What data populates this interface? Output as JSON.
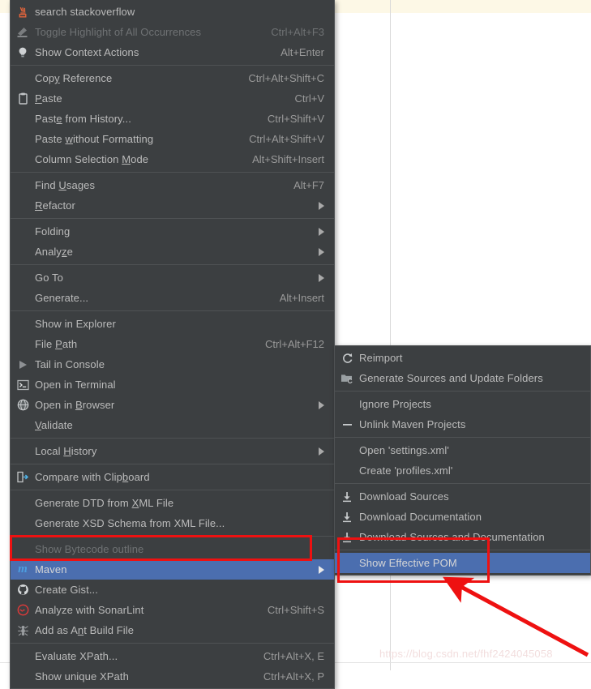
{
  "page": {
    "background": "#ffffff",
    "top_band_color": "#fdf8e6",
    "watermark": "https://blog.csdn.net/fhf2424045058"
  },
  "theme": {
    "menu_bg": "#3c3f41",
    "menu_border": "#4f5254",
    "text": "#bbbbbb",
    "disabled_text": "#6f7274",
    "accel_text": "#9a9a9a",
    "selection": "#4b6eaf",
    "annotation_red": "#ee1111",
    "maven_blue": "#4c9ee0"
  },
  "context_menu": {
    "name": "editor-context-menu",
    "groups": [
      {
        "items": [
          {
            "label": "search stackoverflow",
            "accel": "",
            "icon": "stackoverflow-icon",
            "disabled": false,
            "submenu": false
          },
          {
            "label": "Toggle Highlight of All Occurrences",
            "accel": "Ctrl+Alt+F3",
            "icon": "highlighter-icon",
            "disabled": true,
            "submenu": false
          },
          {
            "label": "Show Context Actions",
            "accel": "Alt+Enter",
            "icon": "lightbulb-icon",
            "disabled": false,
            "submenu": false
          }
        ]
      },
      {
        "items": [
          {
            "label": "Copy Reference",
            "accel": "Ctrl+Alt+Shift+C",
            "icon": "",
            "disabled": false,
            "submenu": false,
            "mnemonic": "y"
          },
          {
            "label": "Paste",
            "accel": "Ctrl+V",
            "icon": "clipboard-icon",
            "disabled": false,
            "submenu": false,
            "mnemonic": "P"
          },
          {
            "label": "Paste from History...",
            "accel": "Ctrl+Shift+V",
            "icon": "",
            "disabled": false,
            "submenu": false,
            "mnemonic": "e"
          },
          {
            "label": "Paste without Formatting",
            "accel": "Ctrl+Alt+Shift+V",
            "icon": "",
            "disabled": false,
            "submenu": false,
            "mnemonic": "w"
          },
          {
            "label": "Column Selection Mode",
            "accel": "Alt+Shift+Insert",
            "icon": "",
            "disabled": false,
            "submenu": false,
            "mnemonic": "M"
          }
        ]
      },
      {
        "items": [
          {
            "label": "Find Usages",
            "accel": "Alt+F7",
            "icon": "",
            "disabled": false,
            "submenu": false,
            "mnemonic": "U"
          },
          {
            "label": "Refactor",
            "accel": "",
            "icon": "",
            "disabled": false,
            "submenu": true,
            "mnemonic": "R"
          }
        ]
      },
      {
        "items": [
          {
            "label": "Folding",
            "accel": "",
            "icon": "",
            "disabled": false,
            "submenu": true
          },
          {
            "label": "Analyze",
            "accel": "",
            "icon": "",
            "disabled": false,
            "submenu": true,
            "mnemonic": "z"
          }
        ]
      },
      {
        "items": [
          {
            "label": "Go To",
            "accel": "",
            "icon": "",
            "disabled": false,
            "submenu": true
          },
          {
            "label": "Generate...",
            "accel": "Alt+Insert",
            "icon": "",
            "disabled": false,
            "submenu": false
          }
        ]
      },
      {
        "items": [
          {
            "label": "Show in Explorer",
            "accel": "",
            "icon": "",
            "disabled": false,
            "submenu": false
          },
          {
            "label": "File Path",
            "accel": "Ctrl+Alt+F12",
            "icon": "",
            "disabled": false,
            "submenu": false,
            "mnemonic": "P"
          },
          {
            "label": "Tail in Console",
            "accel": "",
            "icon": "play-icon",
            "disabled": false,
            "submenu": false
          },
          {
            "label": "Open in Terminal",
            "accel": "",
            "icon": "terminal-icon",
            "disabled": false,
            "submenu": false
          },
          {
            "label": "Open in Browser",
            "accel": "",
            "icon": "globe-icon",
            "disabled": false,
            "submenu": true,
            "mnemonic": "B"
          },
          {
            "label": "Validate",
            "accel": "",
            "icon": "",
            "disabled": false,
            "submenu": false,
            "mnemonic": "V"
          }
        ]
      },
      {
        "items": [
          {
            "label": "Local History",
            "accel": "",
            "icon": "",
            "disabled": false,
            "submenu": true,
            "mnemonic": "H"
          }
        ]
      },
      {
        "items": [
          {
            "label": "Compare with Clipboard",
            "accel": "",
            "icon": "compare-icon",
            "disabled": false,
            "submenu": false,
            "mnemonic": "b"
          }
        ]
      },
      {
        "items": [
          {
            "label": "Generate DTD from XML File",
            "accel": "",
            "icon": "",
            "disabled": false,
            "submenu": false,
            "mnemonic": "X"
          },
          {
            "label": "Generate XSD Schema from XML File...",
            "accel": "",
            "icon": "",
            "disabled": false,
            "submenu": false
          }
        ]
      },
      {
        "items": [
          {
            "label": "Show Bytecode outline",
            "accel": "",
            "icon": "",
            "disabled": true,
            "submenu": false
          },
          {
            "label": "Maven",
            "accel": "",
            "icon": "maven-icon",
            "disabled": false,
            "submenu": true,
            "selected": true
          },
          {
            "label": "Create Gist...",
            "accel": "",
            "icon": "github-icon",
            "disabled": false,
            "submenu": false
          },
          {
            "label": "Analyze with SonarLint",
            "accel": "Ctrl+Shift+S",
            "icon": "sonarlint-icon",
            "disabled": false,
            "submenu": false
          },
          {
            "label": "Add as Ant Build File",
            "accel": "",
            "icon": "ant-icon",
            "disabled": false,
            "submenu": false,
            "mnemonic": "n"
          }
        ]
      },
      {
        "items": [
          {
            "label": "Evaluate XPath...",
            "accel": "Ctrl+Alt+X, E",
            "icon": "",
            "disabled": false,
            "submenu": false
          },
          {
            "label": "Show unique XPath",
            "accel": "Ctrl+Alt+X, P",
            "icon": "",
            "disabled": false,
            "submenu": false
          }
        ]
      }
    ]
  },
  "maven_submenu": {
    "name": "maven-submenu",
    "groups": [
      {
        "items": [
          {
            "label": "Reimport",
            "icon": "refresh-icon",
            "disabled": false
          },
          {
            "label": "Generate Sources and Update Folders",
            "icon": "generate-sources-icon",
            "disabled": false
          }
        ]
      },
      {
        "items": [
          {
            "label": "Ignore Projects",
            "icon": "",
            "disabled": false
          },
          {
            "label": "Unlink Maven Projects",
            "icon": "minus-icon",
            "disabled": false
          }
        ]
      },
      {
        "items": [
          {
            "label": "Open 'settings.xml'",
            "icon": "",
            "disabled": false
          },
          {
            "label": "Create 'profiles.xml'",
            "icon": "",
            "disabled": false
          }
        ]
      },
      {
        "items": [
          {
            "label": "Download Sources",
            "icon": "download-icon",
            "disabled": false
          },
          {
            "label": "Download Documentation",
            "icon": "download-icon",
            "disabled": false
          },
          {
            "label": "Download Sources and Documentation",
            "icon": "download-icon",
            "disabled": false
          }
        ]
      },
      {
        "items": [
          {
            "label": "Show Effective POM",
            "icon": "",
            "disabled": false,
            "selected": true
          }
        ]
      }
    ]
  },
  "annotations": {
    "maven_highlight_box": "red-rectangle-around-maven",
    "pom_highlight_box": "red-rectangle-around-show-effective-pom",
    "pointer_arrow": "red-arrow-pointing-to-show-effective-pom"
  }
}
